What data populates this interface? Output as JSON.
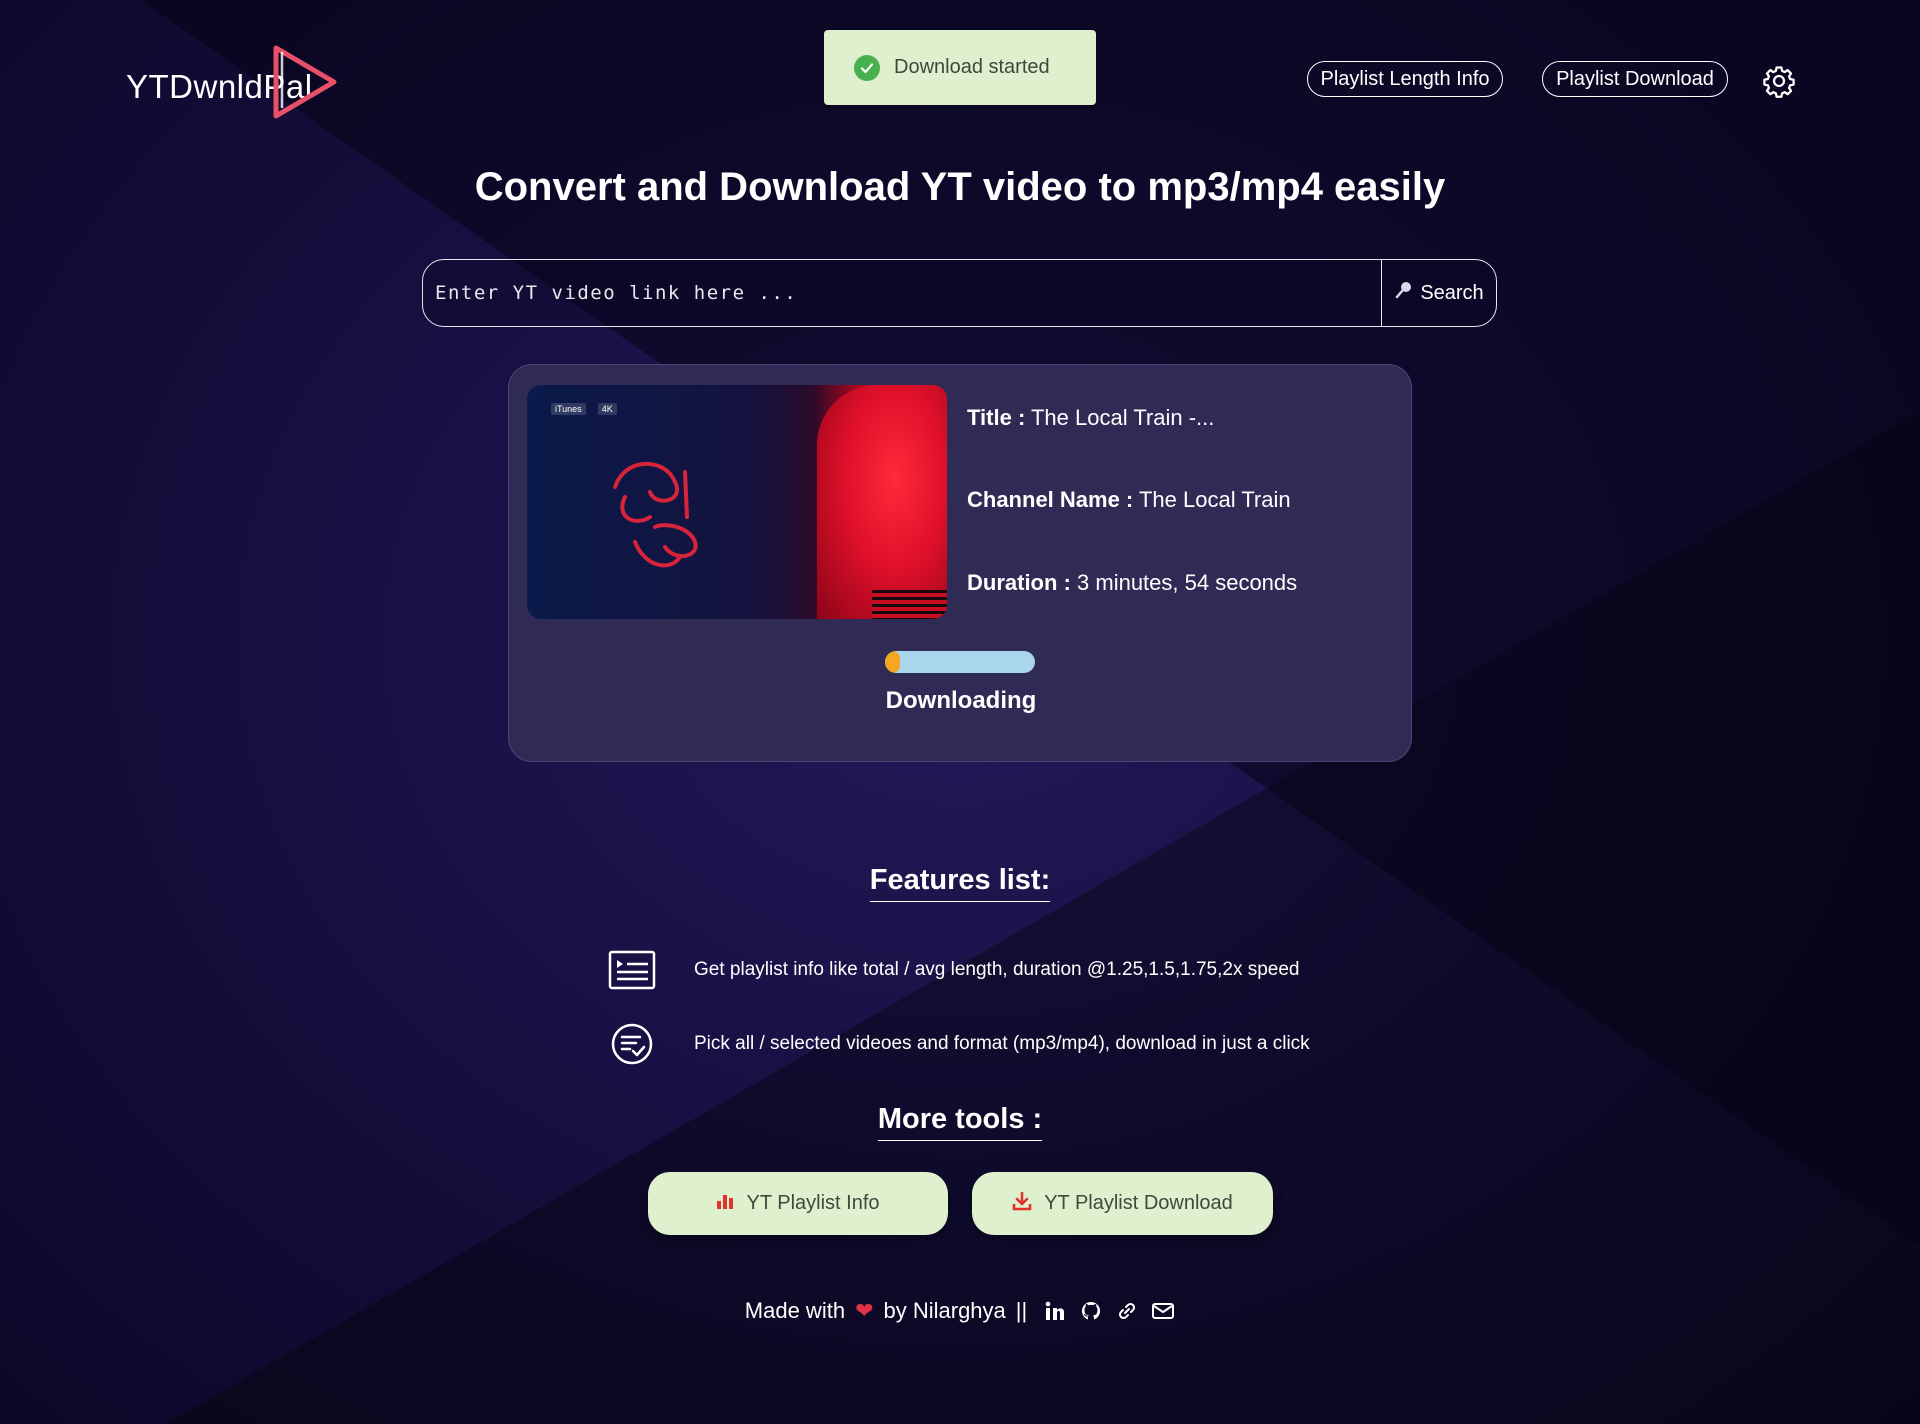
{
  "header": {
    "logo_text": "YTDwnldPal",
    "nav": {
      "playlist_info_label": "Playlist Length Info",
      "playlist_download_label": "Playlist Download"
    }
  },
  "toast": {
    "message": "Download started"
  },
  "hero": {
    "headline": "Convert and Download YT video to mp3/mp4 easily"
  },
  "search": {
    "placeholder": "Enter YT video link here ...",
    "button_label": "Search"
  },
  "video": {
    "title_label": "Title :",
    "title_value": "The Local Train -...",
    "channel_label": "Channel Name :",
    "channel_value": "The Local Train",
    "duration_label": "Duration :",
    "duration_value": "3 minutes, 54 seconds",
    "thumbnail_badges": [
      "iTunes",
      "4K"
    ],
    "progress_fraction": 0.1,
    "status": "Downloading"
  },
  "features": {
    "title": "Features list:",
    "items": [
      "Get playlist info like total / avg length, duration @1.25,1.5,1.75,2x speed",
      "Pick all / selected videoes and format (mp3/mp4), download in just a click"
    ]
  },
  "tools": {
    "title": "More tools :",
    "info_label": "YT Playlist Info",
    "download_label": "YT Playlist Download"
  },
  "footer": {
    "made_with": "Made with",
    "by": "by Nilarghya",
    "separator": "||",
    "icons": [
      "linkedin-icon",
      "github-icon",
      "link-icon",
      "mail-icon"
    ]
  },
  "colors": {
    "background": "#120c36",
    "card": "#302b55",
    "toast_bg": "#dff0cf",
    "toast_check": "#48b04f",
    "progress_track": "#a9d6ea",
    "progress_fill": "#f5a623",
    "accent_red": "#e0334a"
  }
}
